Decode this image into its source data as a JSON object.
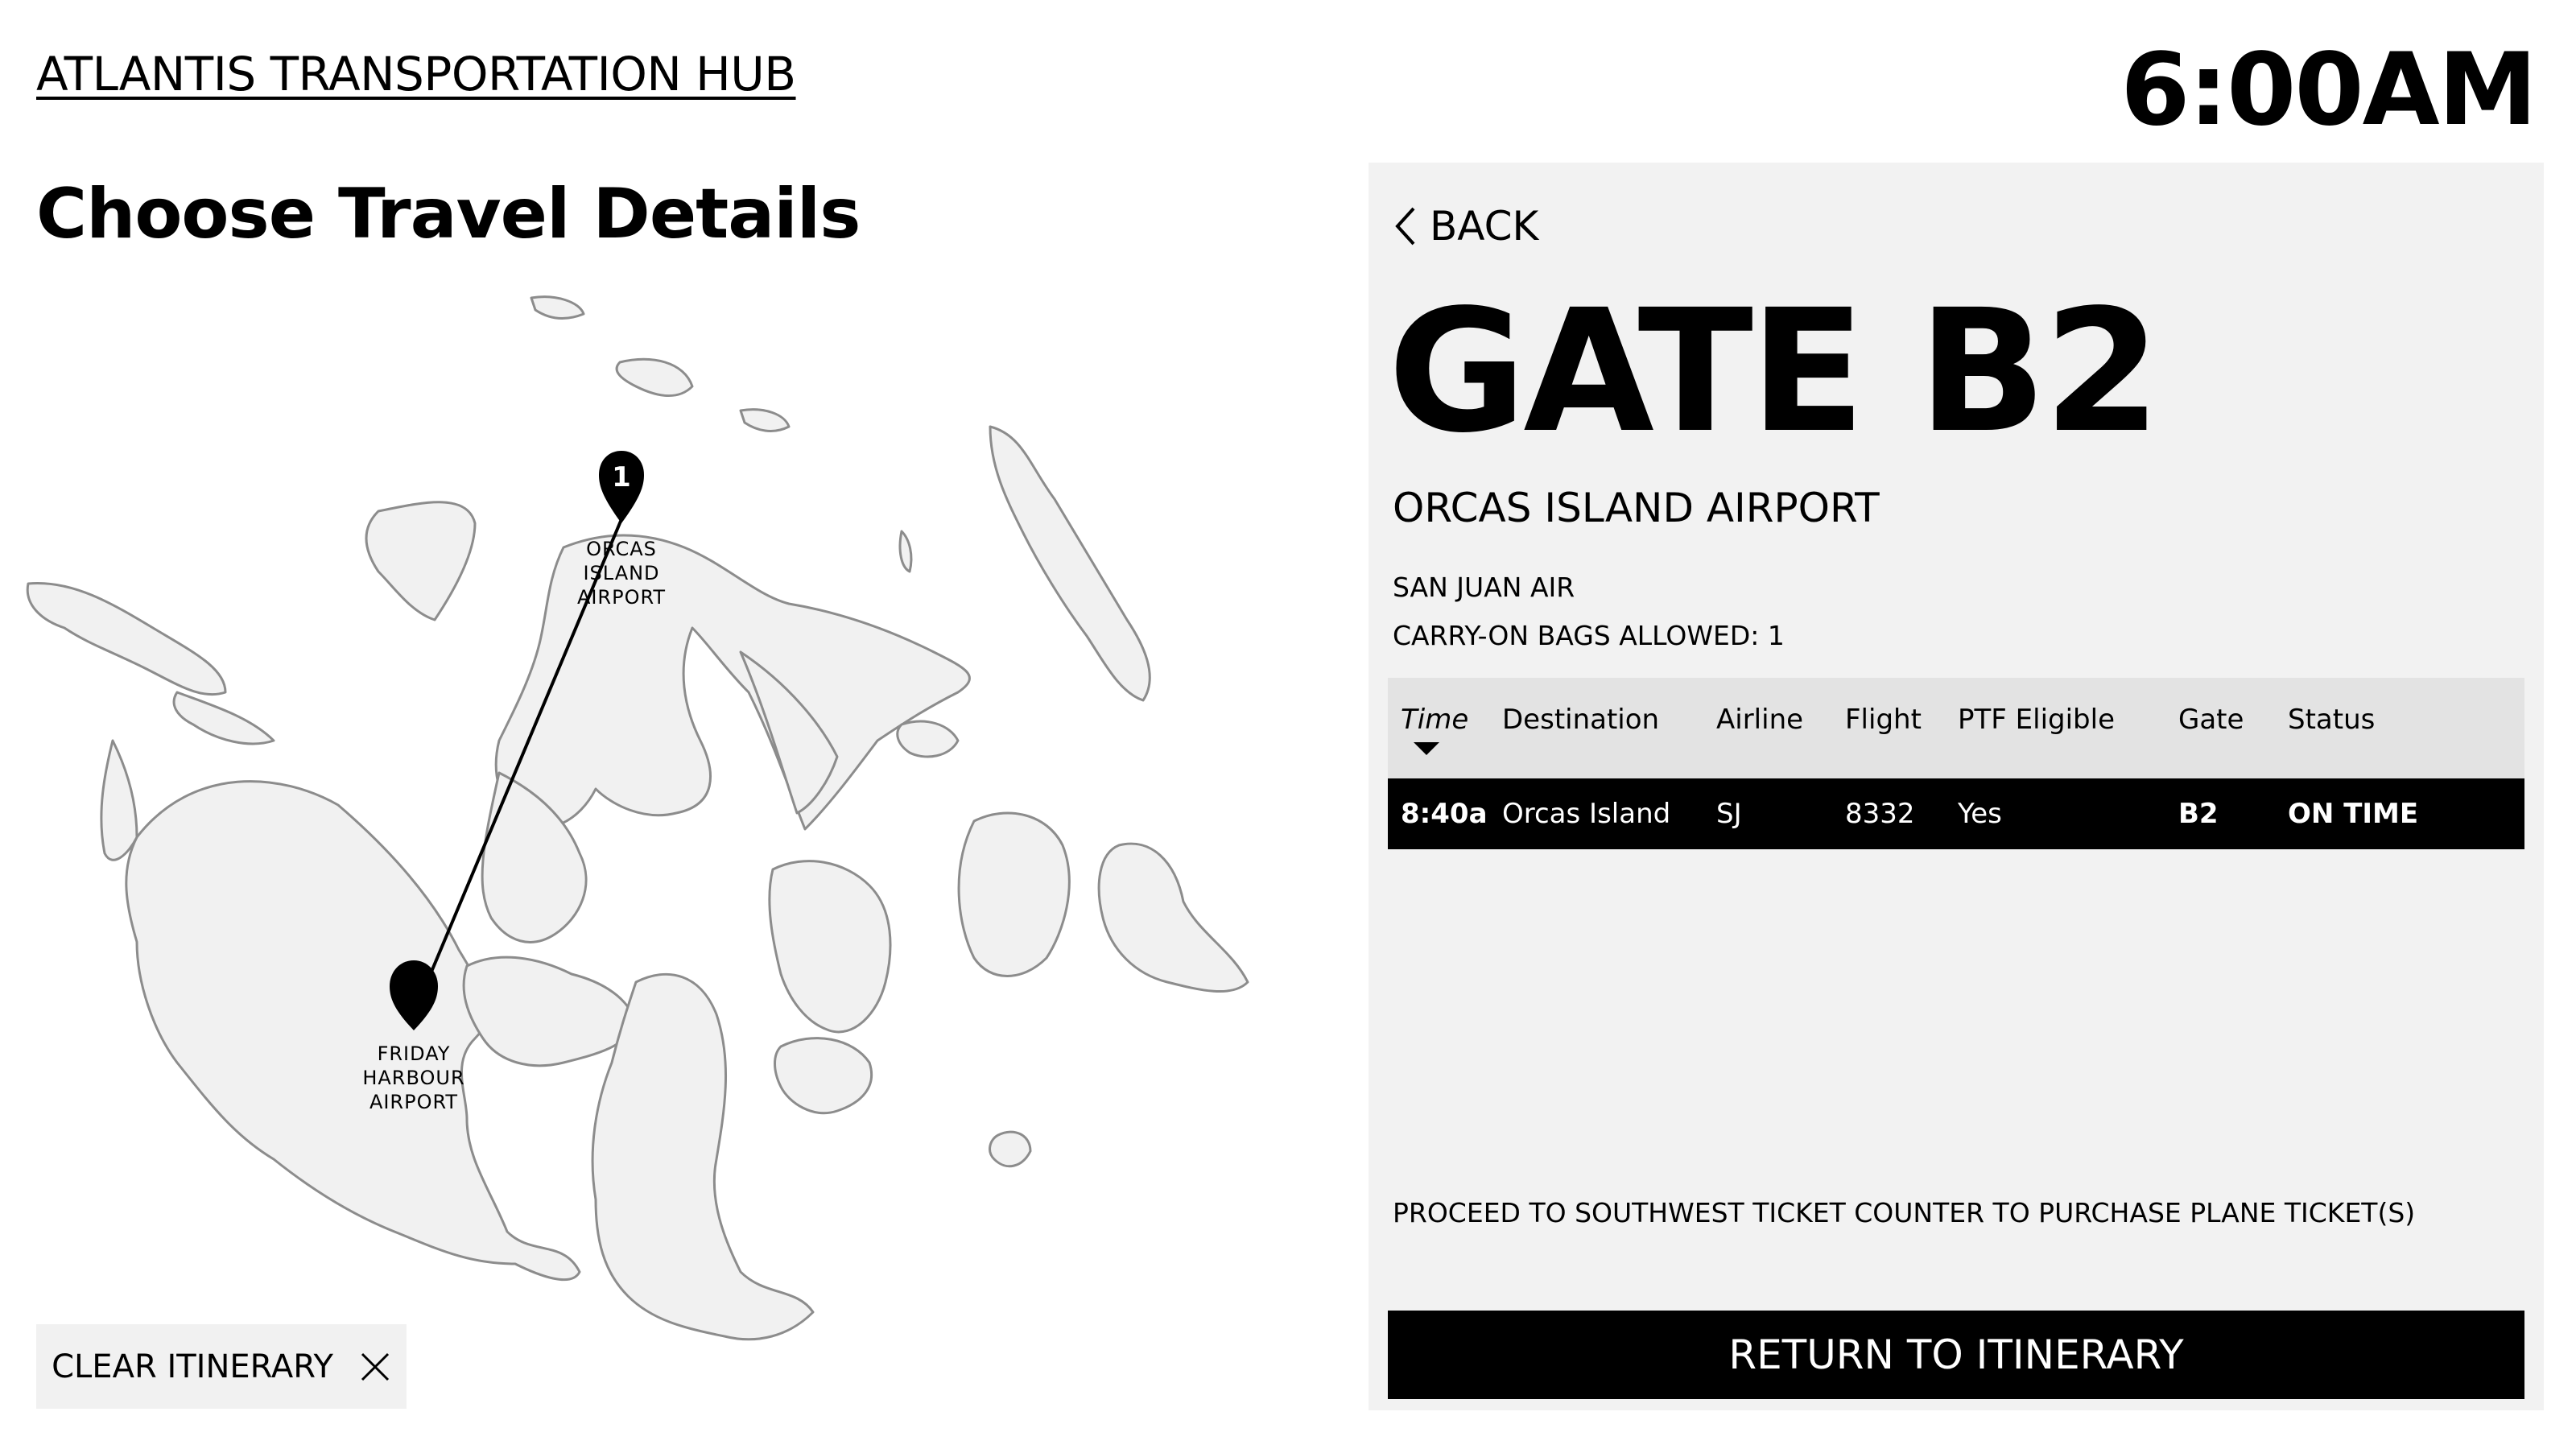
{
  "header": {
    "hub_title": "ATLANTIS TRANSPORTATION HUB",
    "clock": "6:00AM",
    "page_title": "Choose Travel Details"
  },
  "map": {
    "origin": {
      "pin_number": "1",
      "label_lines": [
        "ORCAS",
        "ISLAND",
        "AIRPORT"
      ]
    },
    "destination": {
      "label_lines": [
        "FRIDAY",
        "HARBOUR",
        "AIRPORT"
      ]
    }
  },
  "clear_itinerary": {
    "label": "CLEAR ITINERARY"
  },
  "detail_panel": {
    "back_label": "BACK",
    "gate": "GATE B2",
    "airport": "ORCAS ISLAND AIRPORT",
    "airline": "SAN JUAN AIR",
    "bags": "CARRY-ON BAGS ALLOWED: 1",
    "table": {
      "headers": [
        "Time",
        "Destination",
        "Airline",
        "Flight",
        "PTF Eligible",
        "Gate",
        "Status"
      ],
      "rows": [
        {
          "time": "8:40a",
          "destination": "Orcas Island",
          "airline": "SJ",
          "flight": "8332",
          "ptf": "Yes",
          "gate": "B2",
          "status": "ON TIME"
        }
      ]
    },
    "notice": "PROCEED TO SOUTHWEST TICKET COUNTER TO PURCHASE PLANE TICKET(S)",
    "return_label": "RETURN TO ITINERARY"
  },
  "colors": {
    "panel_bg": "#f2f2f2",
    "header_row_bg": "#e3e3e3",
    "selected_row_bg": "#000000",
    "land_fill": "#f1f1f1"
  },
  "icons": {
    "back": "chevron-left-icon",
    "clear": "close-icon",
    "pin": "map-pin-icon",
    "sort": "caret-down-icon"
  }
}
